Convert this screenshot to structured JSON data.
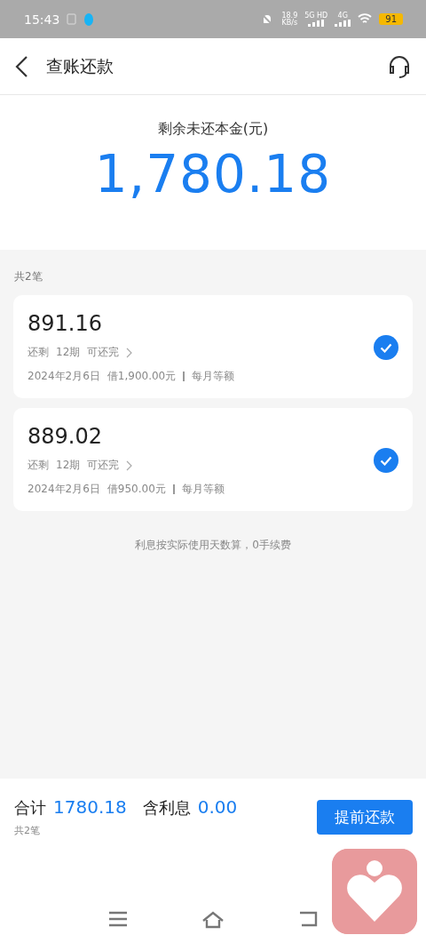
{
  "status_bar": {
    "time": "15:43",
    "speed": "18.9",
    "speed_unit": "KB/s",
    "network_1": "5G HD",
    "network_2": "4G",
    "battery": "91"
  },
  "header": {
    "title": "查账还款"
  },
  "summary": {
    "label": "剩余未还本金(元)",
    "amount": "1,780.18"
  },
  "list": {
    "count": "共2笔",
    "loans": [
      {
        "amount": "891.16",
        "remaining": "还剩",
        "periods": "12期",
        "payoff": "可还完",
        "date": "2024年2月6日",
        "borrowed": "借1,900.00元",
        "method": "每月等额",
        "selected": true
      },
      {
        "amount": "889.02",
        "remaining": "还剩",
        "periods": "12期",
        "payoff": "可还完",
        "date": "2024年2月6日",
        "borrowed": "借950.00元",
        "method": "每月等额",
        "selected": true
      }
    ],
    "note": "利息按实际使用天数算，0手续费"
  },
  "footer": {
    "total_label": "合计",
    "total": "1780.18",
    "interest_label": "含利息",
    "interest": "0.00",
    "count": "共2笔",
    "button": "提前还款"
  }
}
